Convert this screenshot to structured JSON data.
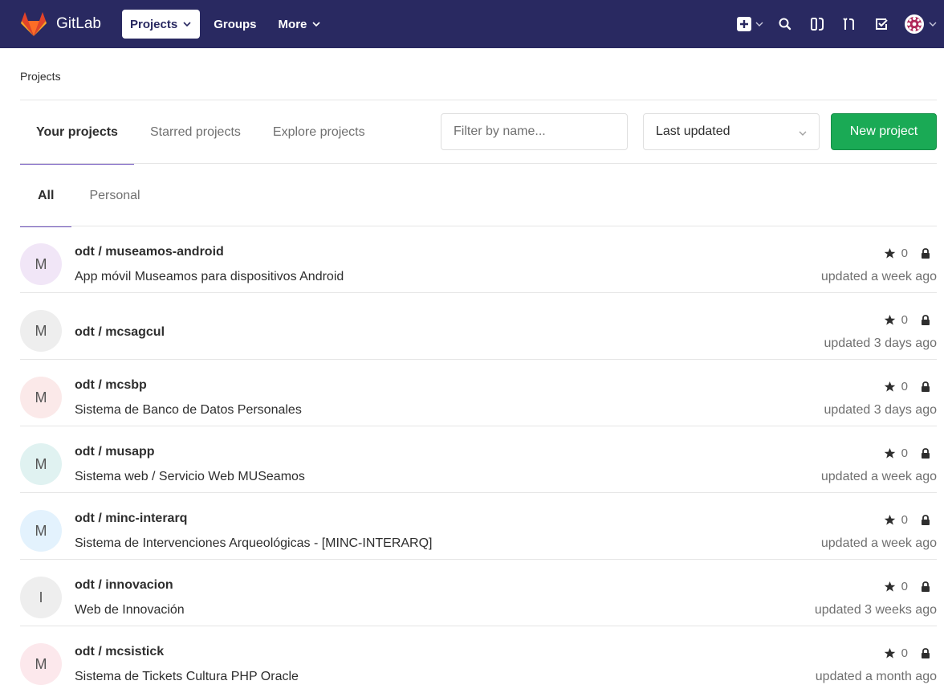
{
  "navbar": {
    "brand": "GitLab",
    "links": [
      {
        "label": "Projects",
        "active": true,
        "dropdown": true
      },
      {
        "label": "Groups",
        "active": false,
        "dropdown": false
      },
      {
        "label": "More",
        "active": false,
        "dropdown": true
      }
    ],
    "icons": [
      "plus-square-icon",
      "search-icon",
      "issues-icon",
      "merge-request-icon",
      "todo-check-icon",
      "user-avatar"
    ]
  },
  "breadcrumb": "Projects",
  "tabs": [
    "Your projects",
    "Starred projects",
    "Explore projects"
  ],
  "filter": {
    "placeholder": "Filter by name...",
    "value": ""
  },
  "sort": {
    "selected": "Last updated"
  },
  "new_project_label": "New project",
  "subtabs": [
    "All",
    "Personal"
  ],
  "projects": [
    {
      "initial": "M",
      "avatar_color": "#f1e6f7",
      "name": "odt / museamos-android",
      "description": "App móvil Museamos para dispositivos Android",
      "stars": "0",
      "updated": "updated a week ago"
    },
    {
      "initial": "M",
      "avatar_color": "#eeeeee",
      "name": "odt / mcsagcul",
      "description": "",
      "stars": "0",
      "updated": "updated 3 days ago"
    },
    {
      "initial": "M",
      "avatar_color": "#fbe9e9",
      "name": "odt / mcsbp",
      "description": "Sistema de Banco de Datos Personales",
      "stars": "0",
      "updated": "updated 3 days ago"
    },
    {
      "initial": "M",
      "avatar_color": "#e0f2f1",
      "name": "odt / musapp",
      "description": "Sistema web / Servicio Web MUSeamos",
      "stars": "0",
      "updated": "updated a week ago"
    },
    {
      "initial": "M",
      "avatar_color": "#e3f2fd",
      "name": "odt / minc-interarq",
      "description": "Sistema de Intervenciones Arqueológicas - [MINC-INTERARQ]",
      "stars": "0",
      "updated": "updated a week ago"
    },
    {
      "initial": "I",
      "avatar_color": "#eeeeee",
      "name": "odt / innovacion",
      "description": "Web de Innovación",
      "stars": "0",
      "updated": "updated 3 weeks ago"
    },
    {
      "initial": "M",
      "avatar_color": "#fce8ec",
      "name": "odt / mcsistick",
      "description": "Sistema de Tickets Cultura PHP Oracle",
      "stars": "0",
      "updated": "updated a month ago"
    }
  ]
}
